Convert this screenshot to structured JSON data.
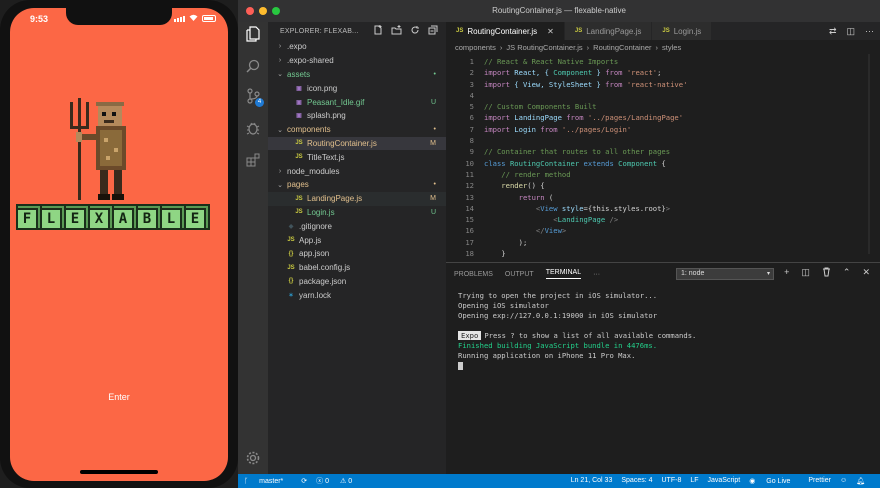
{
  "phone": {
    "time": "9:53",
    "title_letters": [
      "F",
      "L",
      "E",
      "X",
      "A",
      "B",
      "L",
      "E"
    ],
    "enter_label": "Enter"
  },
  "window": {
    "title": "RoutingContainer.js — flexable-native"
  },
  "explorer": {
    "header": "EXPLORER: FLEXAB...",
    "items": [
      {
        "label": ".expo",
        "type": "folder",
        "depth": 0,
        "status": "",
        "color": "#cccccc"
      },
      {
        "label": ".expo-shared",
        "type": "folder",
        "depth": 0,
        "status": "",
        "color": "#cccccc"
      },
      {
        "label": "assets",
        "type": "folder-open",
        "depth": 0,
        "status": "•",
        "color": "#73c991"
      },
      {
        "label": "icon.png",
        "type": "png",
        "depth": 1,
        "status": "",
        "color": "#cccccc"
      },
      {
        "label": "Peasant_Idle.gif",
        "type": "gif",
        "depth": 1,
        "status": "U",
        "color": "#73c991"
      },
      {
        "label": "splash.png",
        "type": "png",
        "depth": 1,
        "status": "",
        "color": "#cccccc"
      },
      {
        "label": "components",
        "type": "folder-open",
        "depth": 0,
        "status": "•",
        "color": "#e2c08d"
      },
      {
        "label": "RoutingContainer.js",
        "type": "js",
        "depth": 1,
        "status": "M",
        "color": "#e2c08d",
        "selected": true
      },
      {
        "label": "TitleText.js",
        "type": "js",
        "depth": 1,
        "status": "",
        "color": "#cccccc"
      },
      {
        "label": "node_modules",
        "type": "folder",
        "depth": 0,
        "status": "",
        "color": "#cccccc"
      },
      {
        "label": "pages",
        "type": "folder-open",
        "depth": 0,
        "status": "•",
        "color": "#e2c08d"
      },
      {
        "label": "LandingPage.js",
        "type": "js",
        "depth": 1,
        "status": "M",
        "color": "#e2c08d",
        "highlight": true
      },
      {
        "label": "Login.js",
        "type": "js",
        "depth": 1,
        "status": "U",
        "color": "#73c991"
      },
      {
        "label": ".gitignore",
        "type": "git",
        "depth": 0,
        "status": "",
        "color": "#cccccc"
      },
      {
        "label": "App.js",
        "type": "js",
        "depth": 0,
        "status": "",
        "color": "#cccccc"
      },
      {
        "label": "app.json",
        "type": "json",
        "depth": 0,
        "status": "",
        "color": "#cccccc"
      },
      {
        "label": "babel.config.js",
        "type": "js",
        "depth": 0,
        "status": "",
        "color": "#cccccc"
      },
      {
        "label": "package.json",
        "type": "json",
        "depth": 0,
        "status": "",
        "color": "#cccccc"
      },
      {
        "label": "yarn.lock",
        "type": "yarn",
        "depth": 0,
        "status": "",
        "color": "#cccccc"
      }
    ]
  },
  "tabs": [
    {
      "label": "RoutingContainer.js",
      "active": true
    },
    {
      "label": "LandingPage.js",
      "active": false
    },
    {
      "label": "Login.js",
      "active": false
    }
  ],
  "breadcrumb": [
    "components",
    "JS RoutingContainer.js",
    "RoutingContainer",
    "styles"
  ],
  "code_lines": [
    {
      "n": "1",
      "segs": [
        [
          "// React & React Native Imports",
          "#6a9955"
        ]
      ]
    },
    {
      "n": "2",
      "segs": [
        [
          "import ",
          "#c586c0"
        ],
        [
          "React, { ",
          "#9cdcfe"
        ],
        [
          "Component",
          "#4ec9b0"
        ],
        [
          " } ",
          "#9cdcfe"
        ],
        [
          "from ",
          "#c586c0"
        ],
        [
          "'react'",
          "#ce9178"
        ],
        [
          ";",
          "#d4d4d4"
        ]
      ]
    },
    {
      "n": "3",
      "segs": [
        [
          "import ",
          "#c586c0"
        ],
        [
          "{ View, StyleSheet } ",
          "#9cdcfe"
        ],
        [
          "from ",
          "#c586c0"
        ],
        [
          "'react-native'",
          "#ce9178"
        ]
      ]
    },
    {
      "n": "4",
      "segs": [
        [
          "",
          "#d4d4d4"
        ]
      ]
    },
    {
      "n": "5",
      "segs": [
        [
          "// Custom Components Built",
          "#6a9955"
        ]
      ]
    },
    {
      "n": "6",
      "segs": [
        [
          "import ",
          "#c586c0"
        ],
        [
          "LandingPage ",
          "#9cdcfe"
        ],
        [
          "from ",
          "#c586c0"
        ],
        [
          "'../pages/LandingPage'",
          "#ce9178"
        ]
      ]
    },
    {
      "n": "7",
      "segs": [
        [
          "import ",
          "#c586c0"
        ],
        [
          "Login ",
          "#9cdcfe"
        ],
        [
          "from ",
          "#c586c0"
        ],
        [
          "'../pages/Login'",
          "#ce9178"
        ]
      ]
    },
    {
      "n": "8",
      "segs": [
        [
          "",
          "#d4d4d4"
        ]
      ]
    },
    {
      "n": "9",
      "segs": [
        [
          "// Container that routes to all other pages",
          "#6a9955"
        ]
      ]
    },
    {
      "n": "10",
      "segs": [
        [
          "class ",
          "#569cd6"
        ],
        [
          "RoutingContainer ",
          "#4ec9b0"
        ],
        [
          "extends ",
          "#569cd6"
        ],
        [
          "Component ",
          "#4ec9b0"
        ],
        [
          "{",
          "#d4d4d4"
        ]
      ]
    },
    {
      "n": "11",
      "segs": [
        [
          "    // render method",
          "#6a9955"
        ]
      ]
    },
    {
      "n": "12",
      "segs": [
        [
          "    render",
          "#dcdcaa"
        ],
        [
          "() {",
          "#d4d4d4"
        ]
      ]
    },
    {
      "n": "13",
      "segs": [
        [
          "        return ",
          "#c586c0"
        ],
        [
          "(",
          "#d4d4d4"
        ]
      ]
    },
    {
      "n": "14",
      "segs": [
        [
          "            <",
          "#808080"
        ],
        [
          "View ",
          "#569cd6"
        ],
        [
          "style",
          "#9cdcfe"
        ],
        [
          "={this.styles.root}",
          "#d4d4d4"
        ],
        [
          ">",
          "#808080"
        ]
      ]
    },
    {
      "n": "15",
      "segs": [
        [
          "                <",
          "#808080"
        ],
        [
          "LandingPage ",
          "#4ec9b0"
        ],
        [
          "/>",
          "#808080"
        ]
      ]
    },
    {
      "n": "16",
      "segs": [
        [
          "            </",
          "#808080"
        ],
        [
          "View",
          "#569cd6"
        ],
        [
          ">",
          "#808080"
        ]
      ]
    },
    {
      "n": "17",
      "segs": [
        [
          "        );",
          "#d4d4d4"
        ]
      ]
    },
    {
      "n": "18",
      "segs": [
        [
          "    }",
          "#d4d4d4"
        ]
      ]
    }
  ],
  "panel": {
    "tabs": [
      "PROBLEMS",
      "OUTPUT",
      "TERMINAL",
      "···"
    ],
    "active_tab": "TERMINAL",
    "terminal_select": "1: node"
  },
  "terminal": {
    "line1": "Trying to open the project in iOS simulator...",
    "line2": "Opening iOS simulator",
    "line3": "Opening exp://127.0.0.1:19000 in iOS simulator",
    "expo_tag": "Expo",
    "line4": "Press ? to show a list of all available commands.",
    "line5": "Finished building JavaScript bundle in 4476ms.",
    "line6": "Running application on iPhone 11 Pro Max."
  },
  "status": {
    "branch": "master*",
    "errors": "0",
    "warnings": "0",
    "position": "Ln 21, Col 33",
    "spaces": "Spaces: 4",
    "encoding": "UTF-8",
    "eol": "LF",
    "language": "JavaScript",
    "golive": "Go Live",
    "prettier": "Prettier"
  },
  "colors": {
    "phone_bg": "#fc6745",
    "tile_green": "#8fd684",
    "vscode_blue": "#007acc"
  }
}
